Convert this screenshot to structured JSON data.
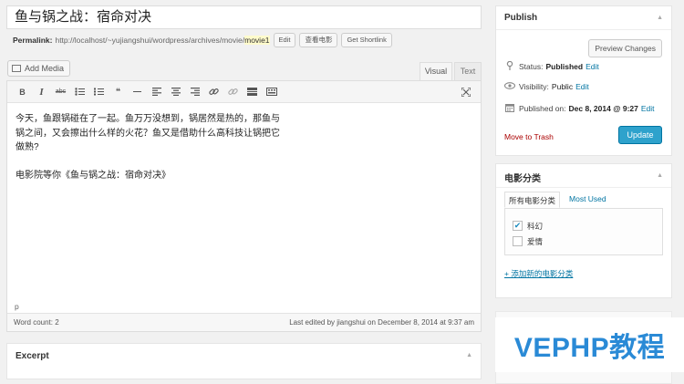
{
  "post": {
    "title": "鱼与锅之战：宿命对决",
    "permalink_label": "Permalink:",
    "permalink_base": "http://localhost/~yujiangshui/wordpress/archives/movie/",
    "permalink_slug": "movie1",
    "edit_label": "Edit",
    "view_label": "查看电影",
    "shortlink_label": "Get Shortlink"
  },
  "editor": {
    "add_media_label": "Add Media",
    "tab_visual": "Visual",
    "tab_text": "Text",
    "toolbar": {
      "bold": "B",
      "italic": "I",
      "strike": "abc",
      "quote": "❝"
    },
    "content_lines": [
      "今天，鱼跟锅碰在了一起。鱼万万没想到，锅居然是热的，那鱼与",
      "锅之间，又会擦出什么样的火花？鱼又是借助什么高科技让锅把它",
      "做熟?",
      "电影院等你《鱼与锅之战：宿命对决》"
    ],
    "path": "p",
    "word_count": "Word count: 2",
    "last_edited": "Last edited by jiangshui on December 8, 2014 at 9:37 am"
  },
  "excerpt": {
    "title": "Excerpt"
  },
  "publish_box": {
    "title": "Publish",
    "preview_label": "Preview Changes",
    "status_label": "Status:",
    "status_value": "Published",
    "visibility_label": "Visibility:",
    "visibility_value": "Public",
    "published_label": "Published on:",
    "published_value": "Dec 8, 2014 @ 9:27",
    "edit_link": "Edit",
    "trash_label": "Move to Trash",
    "update_label": "Update"
  },
  "category_box": {
    "title": "电影分类",
    "tab_all": "所有电影分类",
    "tab_used": "Most Used",
    "items": [
      {
        "label": "科幻",
        "checked": true
      },
      {
        "label": "爱情",
        "checked": false
      }
    ],
    "add_new": "+ 添加新的电影分类"
  },
  "watermark": "VEPHP教程",
  "colors": {
    "primary": "#2ea2cc",
    "link": "#0074a2",
    "trash": "#aa0000",
    "watermark": "#2a8ad6"
  }
}
